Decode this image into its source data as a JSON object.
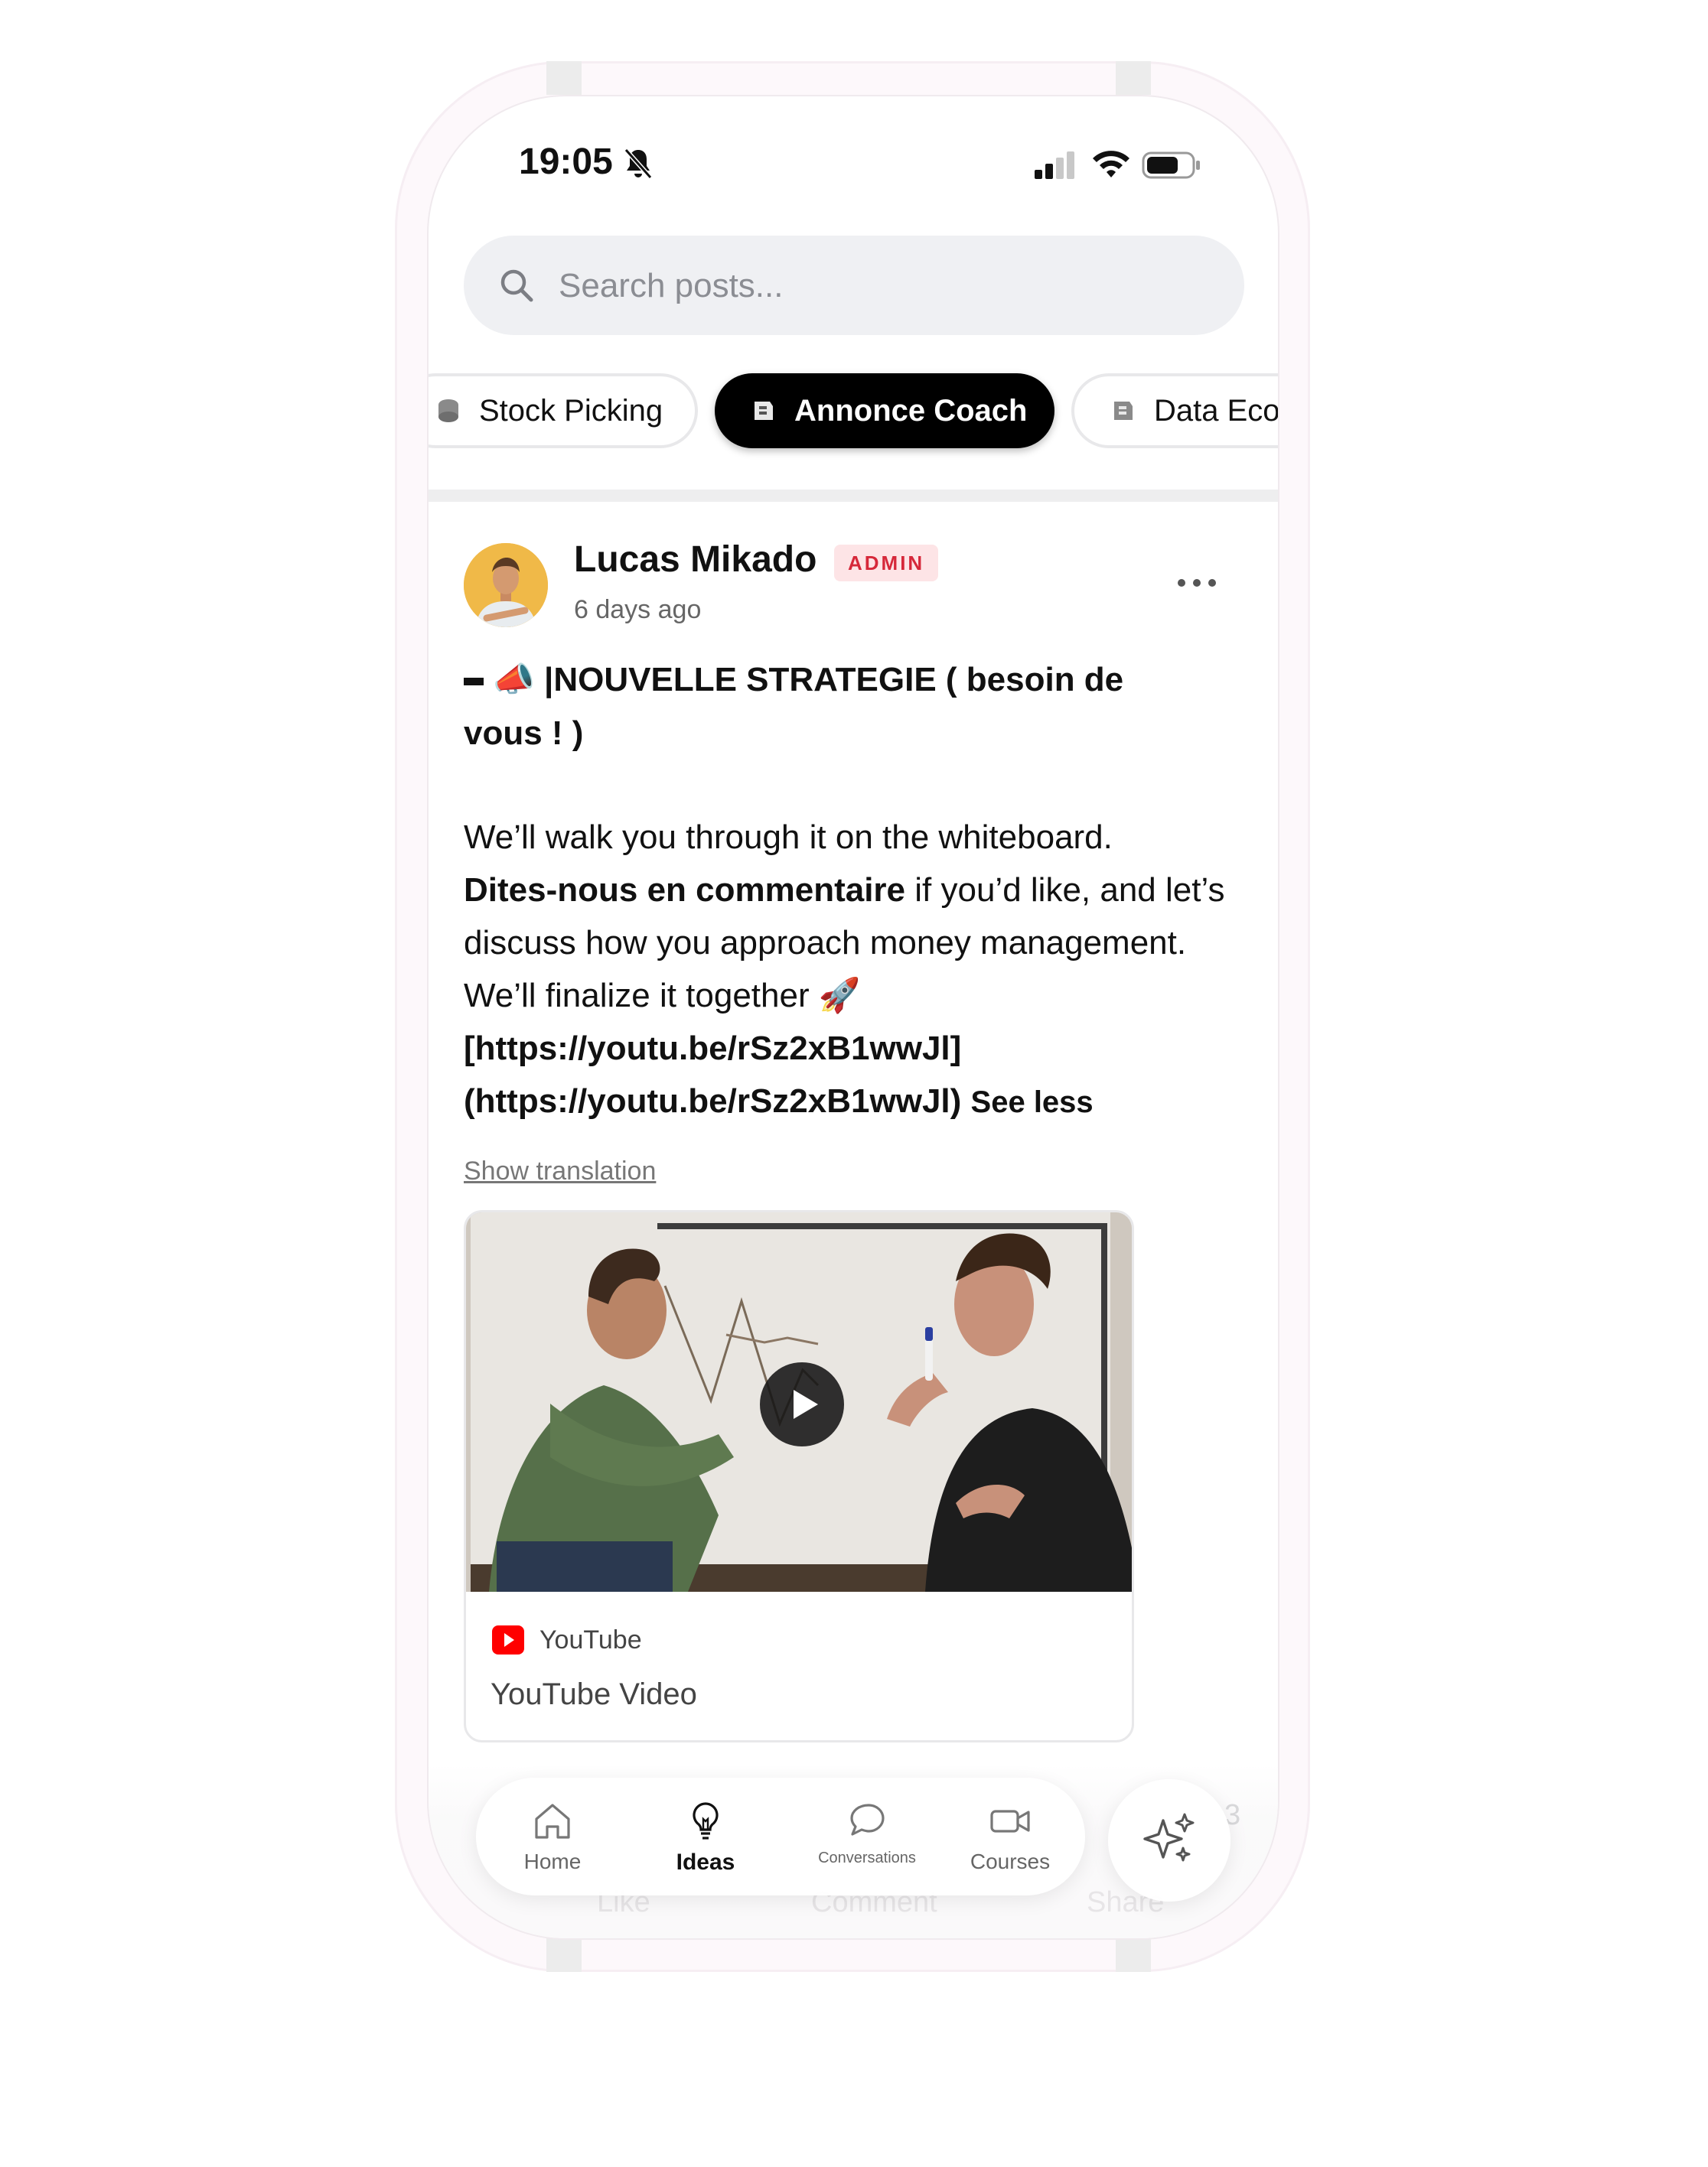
{
  "status_bar": {
    "time": "19:05"
  },
  "search": {
    "placeholder": "Search posts..."
  },
  "categories": [
    {
      "label": "Stock Picking",
      "selected": false
    },
    {
      "label": "Annonce Coach",
      "selected": true
    },
    {
      "label": "Data Eco",
      "selected": false
    }
  ],
  "post": {
    "author": "Lucas Mikado",
    "badge": "ADMIN",
    "time_ago": "6 days ago",
    "title_emoji": "📣",
    "title": "|NOUVELLE STRATEGIE ( besoin de vous ! )",
    "body_line1": " We’ll walk you through it on the whiteboard.",
    "body_bold": "Dites-nous en commentaire",
    "body_line2": " if you’d like, and let’s discuss how you approach money management. We’ll finalize it together ",
    "body_emoji": "🚀",
    "link_text": " [https://youtu.be/rSz2xB1wwJl](https://youtu.be/rSz2xB1wwJl)",
    "see_less": "See less",
    "show_translation": "Show translation",
    "video": {
      "source": "YouTube",
      "title": "YouTube Video"
    }
  },
  "ghost_actions": {
    "like": "Like",
    "comment": "Comment",
    "share": "Share",
    "count": "3"
  },
  "tabbar": {
    "home": "Home",
    "ideas": "Ideas",
    "conversations": "Conversations",
    "courses": "Courses",
    "active": "ideas"
  },
  "colors": {
    "admin_badge_bg": "#fde4e6",
    "admin_badge_text": "#d6283a",
    "chip_active_bg": "#000000",
    "youtube_red": "#ff0000"
  }
}
